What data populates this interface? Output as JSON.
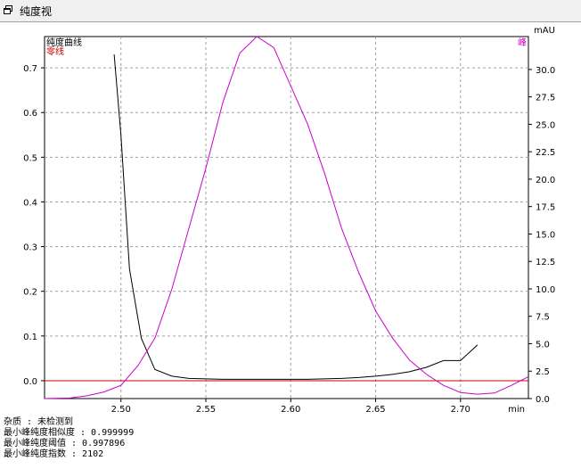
{
  "window": {
    "title": "纯度视"
  },
  "chart_data": {
    "type": "line",
    "xlabel_unit": "min",
    "xlim": [
      2.455,
      2.74
    ],
    "x_ticks": [
      "2.50",
      "2.55",
      "2.60",
      "2.65",
      "2.70"
    ],
    "y_left": {
      "lim": [
        -0.04,
        0.77
      ],
      "ticks": [
        "0.0",
        "0.1",
        "0.2",
        "0.3",
        "0.4",
        "0.5",
        "0.6",
        "0.7"
      ]
    },
    "y_right": {
      "unit": "mAU",
      "lim": [
        0.0,
        33.0
      ],
      "ticks": [
        "0.0",
        "2.5",
        "5.0",
        "7.5",
        "10.0",
        "12.5",
        "15.0",
        "17.5",
        "20.0",
        "22.5",
        "25.0",
        "27.5",
        "30.0"
      ]
    },
    "legend": {
      "placement": "top-left",
      "entries": [
        "纯度曲线",
        "零线"
      ]
    },
    "right_label": "峰",
    "colors": {
      "purity": "#000000",
      "zero": "#cc0000",
      "peak": "#cc00cc",
      "grid": "#a0a0a0"
    },
    "series": [
      {
        "name": "纯度曲线",
        "axis": "left",
        "x": [
          2.496,
          2.5,
          2.505,
          2.512,
          2.52,
          2.53,
          2.54,
          2.55,
          2.56,
          2.57,
          2.58,
          2.59,
          2.6,
          2.61,
          2.62,
          2.63,
          2.64,
          2.65,
          2.66,
          2.67,
          2.68,
          2.69,
          2.7,
          2.71
        ],
        "values": [
          0.73,
          0.55,
          0.25,
          0.095,
          0.025,
          0.01,
          0.005,
          0.004,
          0.003,
          0.003,
          0.003,
          0.003,
          0.003,
          0.003,
          0.004,
          0.005,
          0.007,
          0.01,
          0.014,
          0.02,
          0.03,
          0.045,
          0.045,
          0.08
        ]
      },
      {
        "name": "零线",
        "axis": "left",
        "x": [
          2.455,
          2.74
        ],
        "values": [
          0.0,
          0.0
        ]
      },
      {
        "name": "峰",
        "axis": "right",
        "x": [
          2.455,
          2.47,
          2.48,
          2.49,
          2.5,
          2.51,
          2.52,
          2.53,
          2.54,
          2.55,
          2.56,
          2.57,
          2.58,
          2.59,
          2.6,
          2.61,
          2.62,
          2.63,
          2.64,
          2.65,
          2.66,
          2.67,
          2.68,
          2.69,
          2.7,
          2.71,
          2.72,
          2.73,
          2.74
        ],
        "values": [
          0.0,
          0.05,
          0.25,
          0.6,
          1.2,
          3.0,
          5.5,
          10.0,
          15.5,
          21.0,
          27.0,
          31.5,
          33.0,
          32.0,
          28.5,
          25.0,
          20.5,
          15.5,
          11.5,
          8.0,
          5.5,
          3.5,
          2.2,
          1.2,
          0.55,
          0.4,
          0.5,
          1.2,
          2.0
        ]
      }
    ]
  },
  "info": {
    "lines": [
      "杂质 : 未检测到",
      "最小峰纯度相似度 : 0.999999",
      "最小峰纯度阈值 : 0.997896",
      "最小峰纯度指数 : 2102"
    ]
  }
}
